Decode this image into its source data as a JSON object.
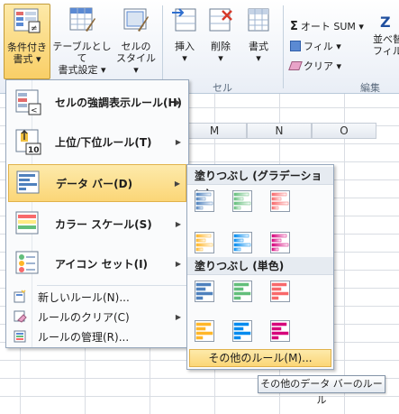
{
  "ribbon": {
    "buttons": [
      {
        "label1": "条件付き",
        "label2": "書式 ▾"
      },
      {
        "label1": "テーブルとして",
        "label2": "書式設定 ▾"
      },
      {
        "label1": "セルの",
        "label2": "スタイル ▾"
      },
      {
        "label1": "挿入",
        "label2": "▾"
      },
      {
        "label1": "削除",
        "label2": "▾"
      },
      {
        "label1": "書式",
        "label2": "▾"
      }
    ],
    "group_cell": "セル",
    "group_edit": "編集",
    "autosum": "オート SUM ▾",
    "fill": "フィル ▾",
    "clear": "クリア ▾",
    "sort1": "並べ替",
    "sort2": "フィル"
  },
  "sheet": {
    "columns": [
      "M",
      "N",
      "O"
    ]
  },
  "menu": {
    "items": [
      {
        "label": "セルの強調表示ルール(H)",
        "icon": "highlight-rules-icon"
      },
      {
        "label": "上位/下位ルール(T)",
        "icon": "top-bottom-rules-icon"
      },
      {
        "label": "データ バー(D)",
        "icon": "data-bars-icon"
      },
      {
        "label": "カラー スケール(S)",
        "icon": "color-scales-icon"
      },
      {
        "label": "アイコン セット(I)",
        "icon": "icon-sets-icon"
      }
    ],
    "small_items": [
      {
        "label": "新しいルール(N)...",
        "icon": "new-rule-icon"
      },
      {
        "label": "ルールのクリア(C)",
        "icon": "clear-rules-icon"
      },
      {
        "label": "ルールの管理(R)...",
        "icon": "manage-rules-icon"
      }
    ]
  },
  "submenu": {
    "gradient_header": "塗りつぶし (グラデーション)",
    "solid_header": "塗りつぶし (単色)",
    "more_rules": "その他のルール(M)...",
    "colors": [
      "#4f81bd",
      "#63be7b",
      "#f8696b",
      "#ffb628",
      "#008aef",
      "#d6007b"
    ]
  },
  "tooltip": "その他のデータ バーのルール"
}
